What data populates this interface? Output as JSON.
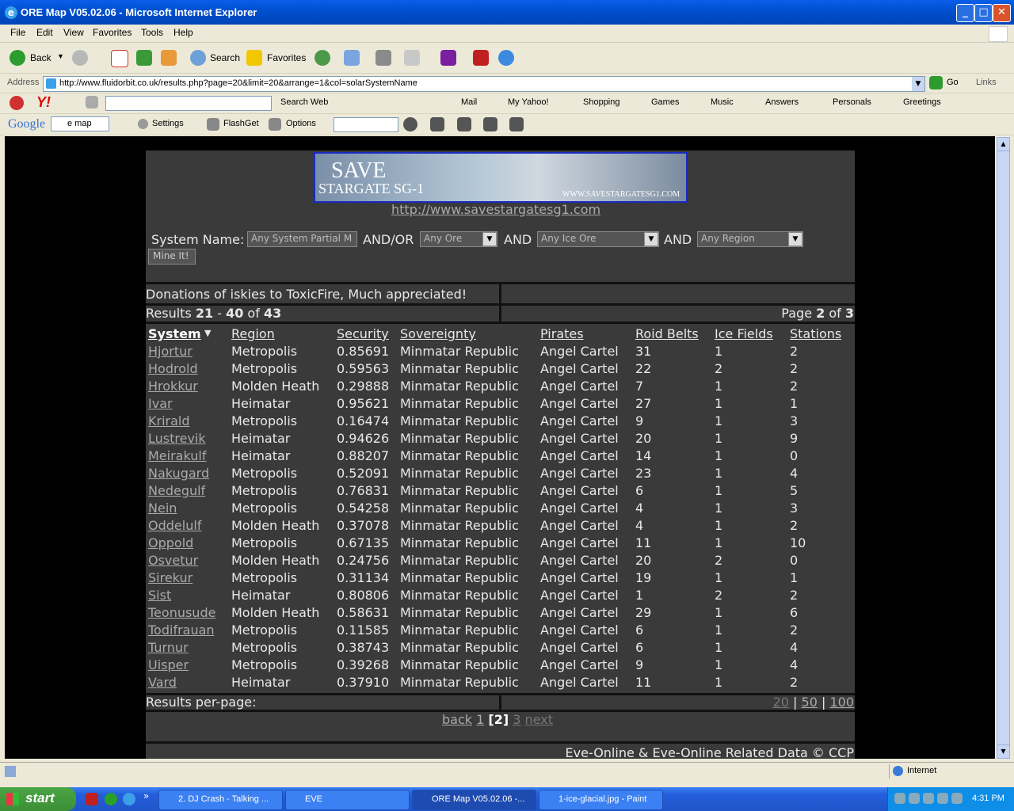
{
  "window": {
    "title": "ORE Map V05.02.06 - Microsoft Internet Explorer"
  },
  "menu": [
    "File",
    "Edit",
    "View",
    "Favorites",
    "Tools",
    "Help"
  ],
  "toolbar": {
    "back": "Back",
    "search": "Search",
    "favorites": "Favorites"
  },
  "address": {
    "label": "Address",
    "url": "http://www.fluidorbit.co.uk/results.php?page=20&limit=20&arrange=1&col=solarSystemName",
    "go": "Go",
    "links": "Links"
  },
  "yahoo_bar": {
    "search_web": "Search Web",
    "mail": "Mail",
    "my_yahoo": "My Yahoo!",
    "shopping": "Shopping",
    "games": "Games",
    "music": "Music",
    "answers": "Answers",
    "personals": "Personals",
    "greetings": "Greetings"
  },
  "google_bar": {
    "logo": "Google",
    "field": "e map",
    "settings": "Settings",
    "flashget": "FlashGet",
    "options": "Options"
  },
  "banner": {
    "line1": "SAVE",
    "line2": "STARGATE SG-1",
    "site": "WWW.SAVESTARGATESG1.COM",
    "link": "http://www.savestargatesg1.com"
  },
  "search_form": {
    "system_label": "System Name:",
    "system_placeholder": "Any System Partial M",
    "andor": "AND/OR",
    "ore": "Any Ore",
    "and1": "AND",
    "ice": "Any Ice Ore",
    "and2": "AND",
    "region": "Any Region",
    "submit": "Mine It!"
  },
  "donations": "Donations of iskies to ToxicFire, Much appreciated!",
  "results_summary": {
    "prefix": "Results ",
    "from": "21",
    "dash": " - ",
    "to": "40",
    "of": " of ",
    "total": "43"
  },
  "page_summary": {
    "prefix": "Page ",
    "current": "2",
    "of": " of ",
    "total": "3"
  },
  "columns": [
    "System",
    "Region",
    "Security",
    "Sovereignty",
    "Pirates",
    "Roid Belts",
    "Ice Fields",
    "Stations"
  ],
  "rows": [
    [
      "Hjortur",
      "Metropolis",
      "0.85691",
      "Minmatar Republic",
      "Angel Cartel",
      "31",
      "1",
      "2"
    ],
    [
      "Hodrold",
      "Metropolis",
      "0.59563",
      "Minmatar Republic",
      "Angel Cartel",
      "22",
      "2",
      "2"
    ],
    [
      "Hrokkur",
      "Molden Heath",
      "0.29888",
      "Minmatar Republic",
      "Angel Cartel",
      "7",
      "1",
      "2"
    ],
    [
      "Ivar",
      "Heimatar",
      "0.95621",
      "Minmatar Republic",
      "Angel Cartel",
      "27",
      "1",
      "1"
    ],
    [
      "Krirald",
      "Metropolis",
      "0.16474",
      "Minmatar Republic",
      "Angel Cartel",
      "9",
      "1",
      "3"
    ],
    [
      "Lustrevik",
      "Heimatar",
      "0.94626",
      "Minmatar Republic",
      "Angel Cartel",
      "20",
      "1",
      "9"
    ],
    [
      "Meirakulf",
      "Heimatar",
      "0.88207",
      "Minmatar Republic",
      "Angel Cartel",
      "14",
      "1",
      "0"
    ],
    [
      "Nakugard",
      "Metropolis",
      "0.52091",
      "Minmatar Republic",
      "Angel Cartel",
      "23",
      "1",
      "4"
    ],
    [
      "Nedegulf",
      "Metropolis",
      "0.76831",
      "Minmatar Republic",
      "Angel Cartel",
      "6",
      "1",
      "5"
    ],
    [
      "Nein",
      "Metropolis",
      "0.54258",
      "Minmatar Republic",
      "Angel Cartel",
      "4",
      "1",
      "3"
    ],
    [
      "Oddelulf",
      "Molden Heath",
      "0.37078",
      "Minmatar Republic",
      "Angel Cartel",
      "4",
      "1",
      "2"
    ],
    [
      "Oppold",
      "Metropolis",
      "0.67135",
      "Minmatar Republic",
      "Angel Cartel",
      "11",
      "1",
      "10"
    ],
    [
      "Osvetur",
      "Molden Heath",
      "0.24756",
      "Minmatar Republic",
      "Angel Cartel",
      "20",
      "2",
      "0"
    ],
    [
      "Sirekur",
      "Metropolis",
      "0.31134",
      "Minmatar Republic",
      "Angel Cartel",
      "19",
      "1",
      "1"
    ],
    [
      "Sist",
      "Heimatar",
      "0.80806",
      "Minmatar Republic",
      "Angel Cartel",
      "1",
      "2",
      "2"
    ],
    [
      "Teonusude",
      "Molden Heath",
      "0.58631",
      "Minmatar Republic",
      "Angel Cartel",
      "29",
      "1",
      "6"
    ],
    [
      "Todifrauan",
      "Metropolis",
      "0.11585",
      "Minmatar Republic",
      "Angel Cartel",
      "6",
      "1",
      "2"
    ],
    [
      "Turnur",
      "Metropolis",
      "0.38743",
      "Minmatar Republic",
      "Angel Cartel",
      "6",
      "1",
      "4"
    ],
    [
      "Uisper",
      "Metropolis",
      "0.39268",
      "Minmatar Republic",
      "Angel Cartel",
      "9",
      "1",
      "4"
    ],
    [
      "Vard",
      "Heimatar",
      "0.37910",
      "Minmatar Republic",
      "Angel Cartel",
      "11",
      "1",
      "2"
    ]
  ],
  "per_page": {
    "label": "Results per-page:",
    "opt20": "20",
    "opt50": "50",
    "opt100": "100",
    "sep": "|"
  },
  "pager": {
    "back": "back",
    "p1": "1",
    "p2": "[2]",
    "p3": "3",
    "next": "next"
  },
  "footer": "Eve-Online & Eve-Online Related Data © CCP",
  "status": {
    "zone": "Internet"
  },
  "taskbar": {
    "start": "start",
    "tasks": [
      "2. DJ Crash - Talking ...",
      "EVE",
      "ORE Map V05.02.06 -...",
      "1-ice-glacial.jpg - Paint"
    ],
    "clock": "4:31 PM"
  }
}
